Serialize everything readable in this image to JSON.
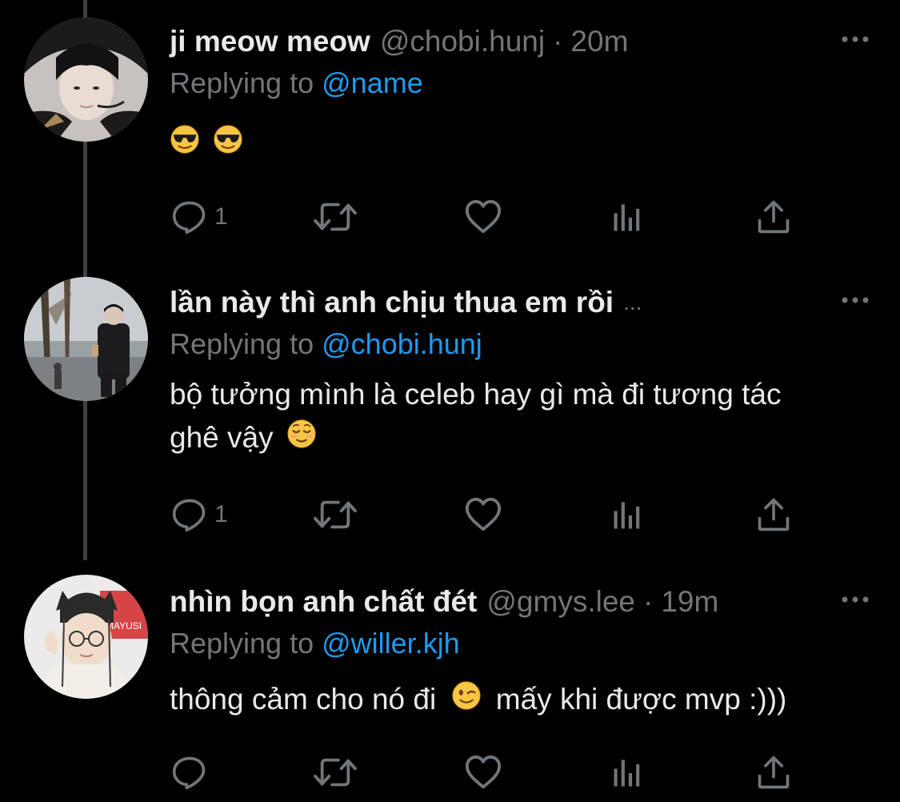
{
  "colors": {
    "background": "#000000",
    "text_primary": "#e7e9ea",
    "text_secondary": "#71767b",
    "link": "#1d9bf0",
    "thread_line": "#3e4144"
  },
  "tweets": [
    {
      "name": "ji meow meow",
      "handle": "@chobi.hunj",
      "dot": "·",
      "time": "20m",
      "replying_prefix": "Replying to",
      "replying_to": "@name",
      "body_emojis": [
        "smiling-face-with-sunglasses",
        "smiling-face-with-sunglasses"
      ],
      "reply_count": "1",
      "icons": [
        "reply-icon",
        "retweet-icon",
        "like-icon",
        "analytics-icon",
        "share-icon"
      ]
    },
    {
      "name": "lần này thì anh chịu thua em rồi",
      "name_truncation": "...",
      "replying_prefix": "Replying to",
      "replying_to": "@chobi.hunj",
      "body_line1": "bộ tưởng mình là celeb hay gì mà đi tương tác",
      "body_line2": "ghê vậy",
      "body_emoji": "relieved-face",
      "reply_count": "1",
      "icons": [
        "reply-icon",
        "retweet-icon",
        "like-icon",
        "analytics-icon",
        "share-icon"
      ]
    },
    {
      "name": "nhìn bọn anh chất đét",
      "handle": "@gmys.lee",
      "dot": "·",
      "time": "19m",
      "replying_prefix": "Replying to",
      "replying_to": "@willer.kjh",
      "body_part1": "thông cảm cho nó đi",
      "body_emoji": "winking-face",
      "body_part2": "mấy khi được mvp :)))",
      "avatar_text": "MAYUSI",
      "reply_count": "",
      "icons": [
        "reply-icon",
        "retweet-icon",
        "like-icon",
        "analytics-icon",
        "share-icon"
      ]
    }
  ]
}
